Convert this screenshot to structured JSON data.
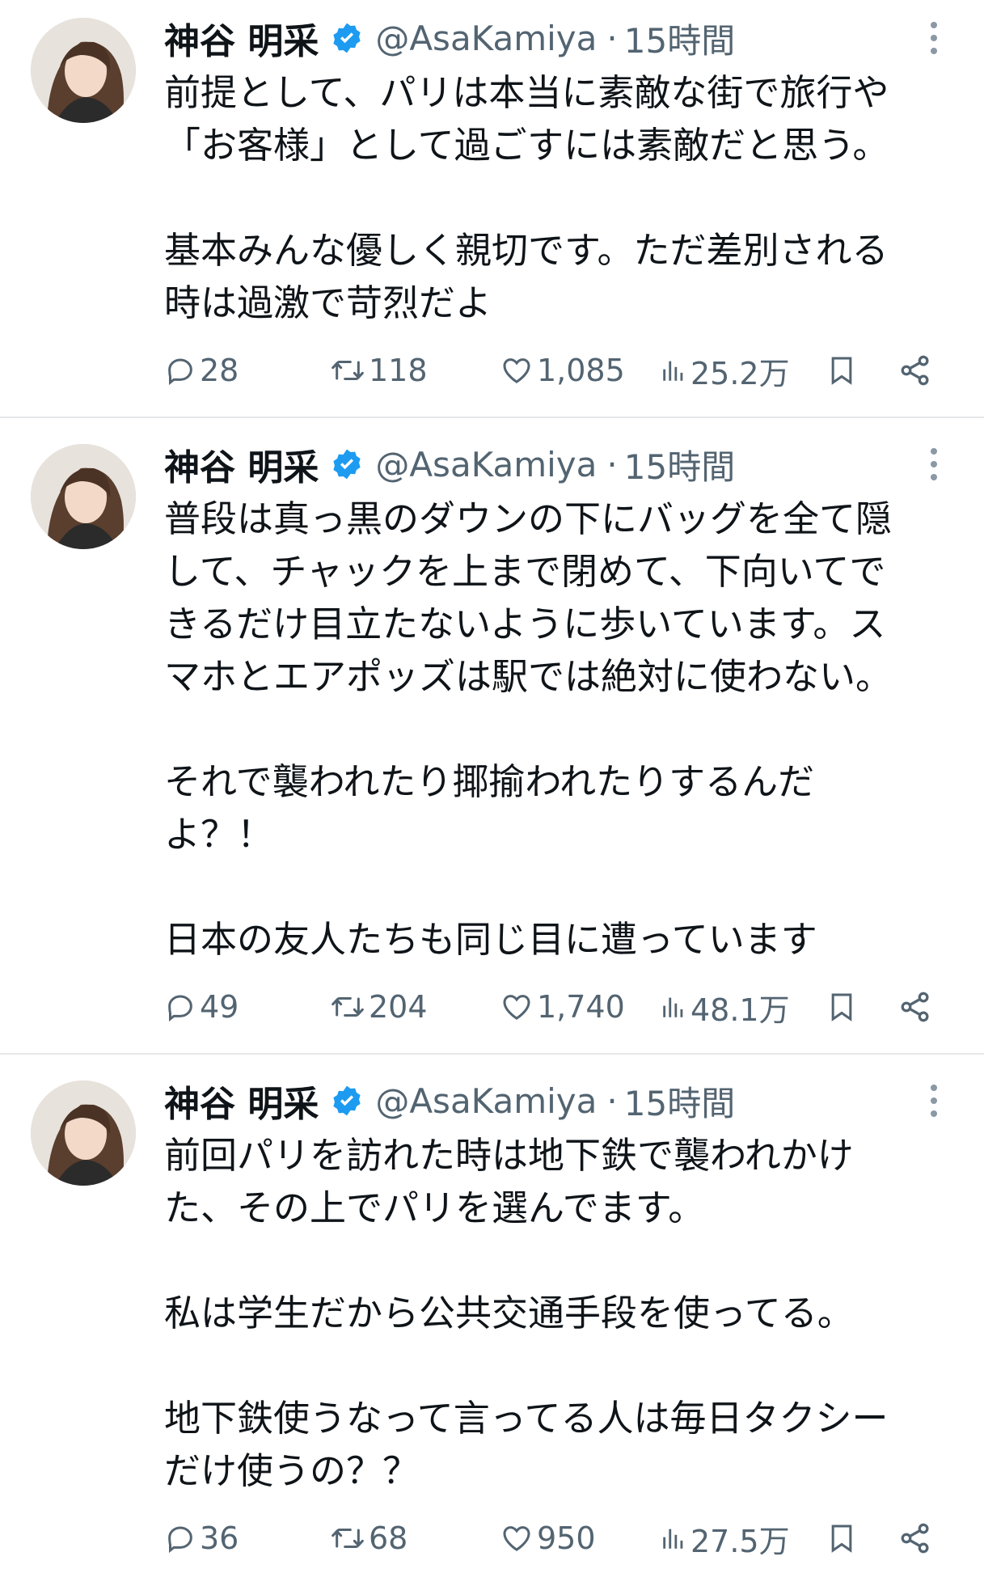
{
  "tweets": [
    {
      "author_name": "神谷 明采",
      "handle": "@AsaKamiya",
      "separator": "·",
      "time": "15時間",
      "body": [
        "前提として、パリは本当に素敵な街で旅行や",
        "「お客様」として過ごすには素敵だと思う。",
        "",
        "基本みんな優しく親切です。ただ差別される",
        "時は過激で苛烈だよ"
      ],
      "replies": "28",
      "retweets": "118",
      "likes": "1,085",
      "views": "25.2万"
    },
    {
      "author_name": "神谷 明采",
      "handle": "@AsaKamiya",
      "separator": "·",
      "time": "15時間",
      "body": [
        "普段は真っ黒のダウンの下にバッグを全て隠",
        "して、チャックを上まで閉めて、下向いてで",
        "きるだけ目立たないように歩いています。ス",
        "マホとエアポッズは駅では絶対に使わない。",
        "",
        "それで襲われたり揶揄われたりするんだ",
        "よ？！",
        "",
        "日本の友人たちも同じ目に遭っています"
      ],
      "replies": "49",
      "retweets": "204",
      "likes": "1,740",
      "views": "48.1万"
    },
    {
      "author_name": "神谷 明采",
      "handle": "@AsaKamiya",
      "separator": "·",
      "time": "15時間",
      "body": [
        "前回パリを訪れた時は地下鉄で襲われかけ",
        "た、その上でパリを選んでます。",
        "",
        "私は学生だから公共交通手段を使ってる。",
        "",
        "地下鉄使うなって言ってる人は毎日タクシー",
        "だけ使うの？？"
      ],
      "replies": "36",
      "retweets": "68",
      "likes": "950",
      "views": "27.5万"
    }
  ],
  "icons": {
    "verified": "verified-badge-icon",
    "more": "more-vertical-icon",
    "reply": "reply-icon",
    "retweet": "retweet-icon",
    "like": "heart-icon",
    "views": "views-bar-chart-icon",
    "bookmark": "bookmark-icon",
    "share": "share-icon"
  },
  "colors": {
    "verified_blue": "#1d9bf0",
    "text_primary": "#0f1419",
    "text_secondary": "#536471",
    "divider": "#e6e8ea"
  }
}
